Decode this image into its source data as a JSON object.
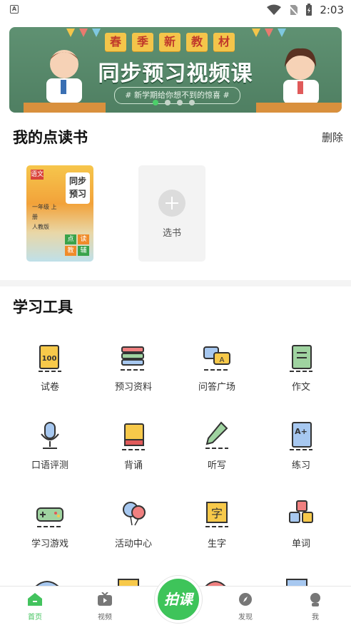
{
  "status_bar": {
    "time": "2:03",
    "left_badge": "A"
  },
  "banner": {
    "title_chars": [
      "春",
      "季",
      "新",
      "教",
      "材"
    ],
    "main_text": "同步预习视频课",
    "sub_text": "# 新学期给你想不到的惊喜 #",
    "page_count": 4,
    "active_page": 1
  },
  "my_books": {
    "title": "我的点读书",
    "delete_label": "删除",
    "book": {
      "subject_badge": "语文",
      "cover_title_line1": "同步",
      "cover_title_line2": "预习",
      "grade_line1": "一年级 上册",
      "grade_line2": "人教版",
      "corner_tags": [
        "点",
        "读",
        "教",
        "辅"
      ]
    },
    "add_label": "选书"
  },
  "tools": {
    "title": "学习工具",
    "items": [
      {
        "label": "试卷",
        "icon": "exam-paper-icon"
      },
      {
        "label": "预习资料",
        "icon": "books-stack-icon"
      },
      {
        "label": "问答广场",
        "icon": "qa-bubbles-icon"
      },
      {
        "label": "作文",
        "icon": "notebook-icon"
      },
      {
        "label": "口语评测",
        "icon": "microphone-icon"
      },
      {
        "label": "背诵",
        "icon": "book-icon"
      },
      {
        "label": "听写",
        "icon": "pencil-icon"
      },
      {
        "label": "练习",
        "icon": "grade-sheet-icon"
      },
      {
        "label": "学习游戏",
        "icon": "gamepad-icon"
      },
      {
        "label": "活动中心",
        "icon": "balloons-icon"
      },
      {
        "label": "生字",
        "icon": "character-card-icon"
      },
      {
        "label": "单词",
        "icon": "letter-blocks-icon"
      }
    ]
  },
  "bottom_nav": {
    "items": [
      {
        "label": "首页",
        "icon": "home-icon",
        "active": true
      },
      {
        "label": "视频",
        "icon": "tv-icon",
        "active": false
      },
      {
        "label": "发现",
        "icon": "compass-icon",
        "active": false
      },
      {
        "label": "我",
        "icon": "profile-icon",
        "active": false
      }
    ],
    "center_label": "拍课"
  },
  "colors": {
    "accent": "#43c35e",
    "banner_bg": "#5f9172",
    "title_tag": "#f4c54a"
  }
}
